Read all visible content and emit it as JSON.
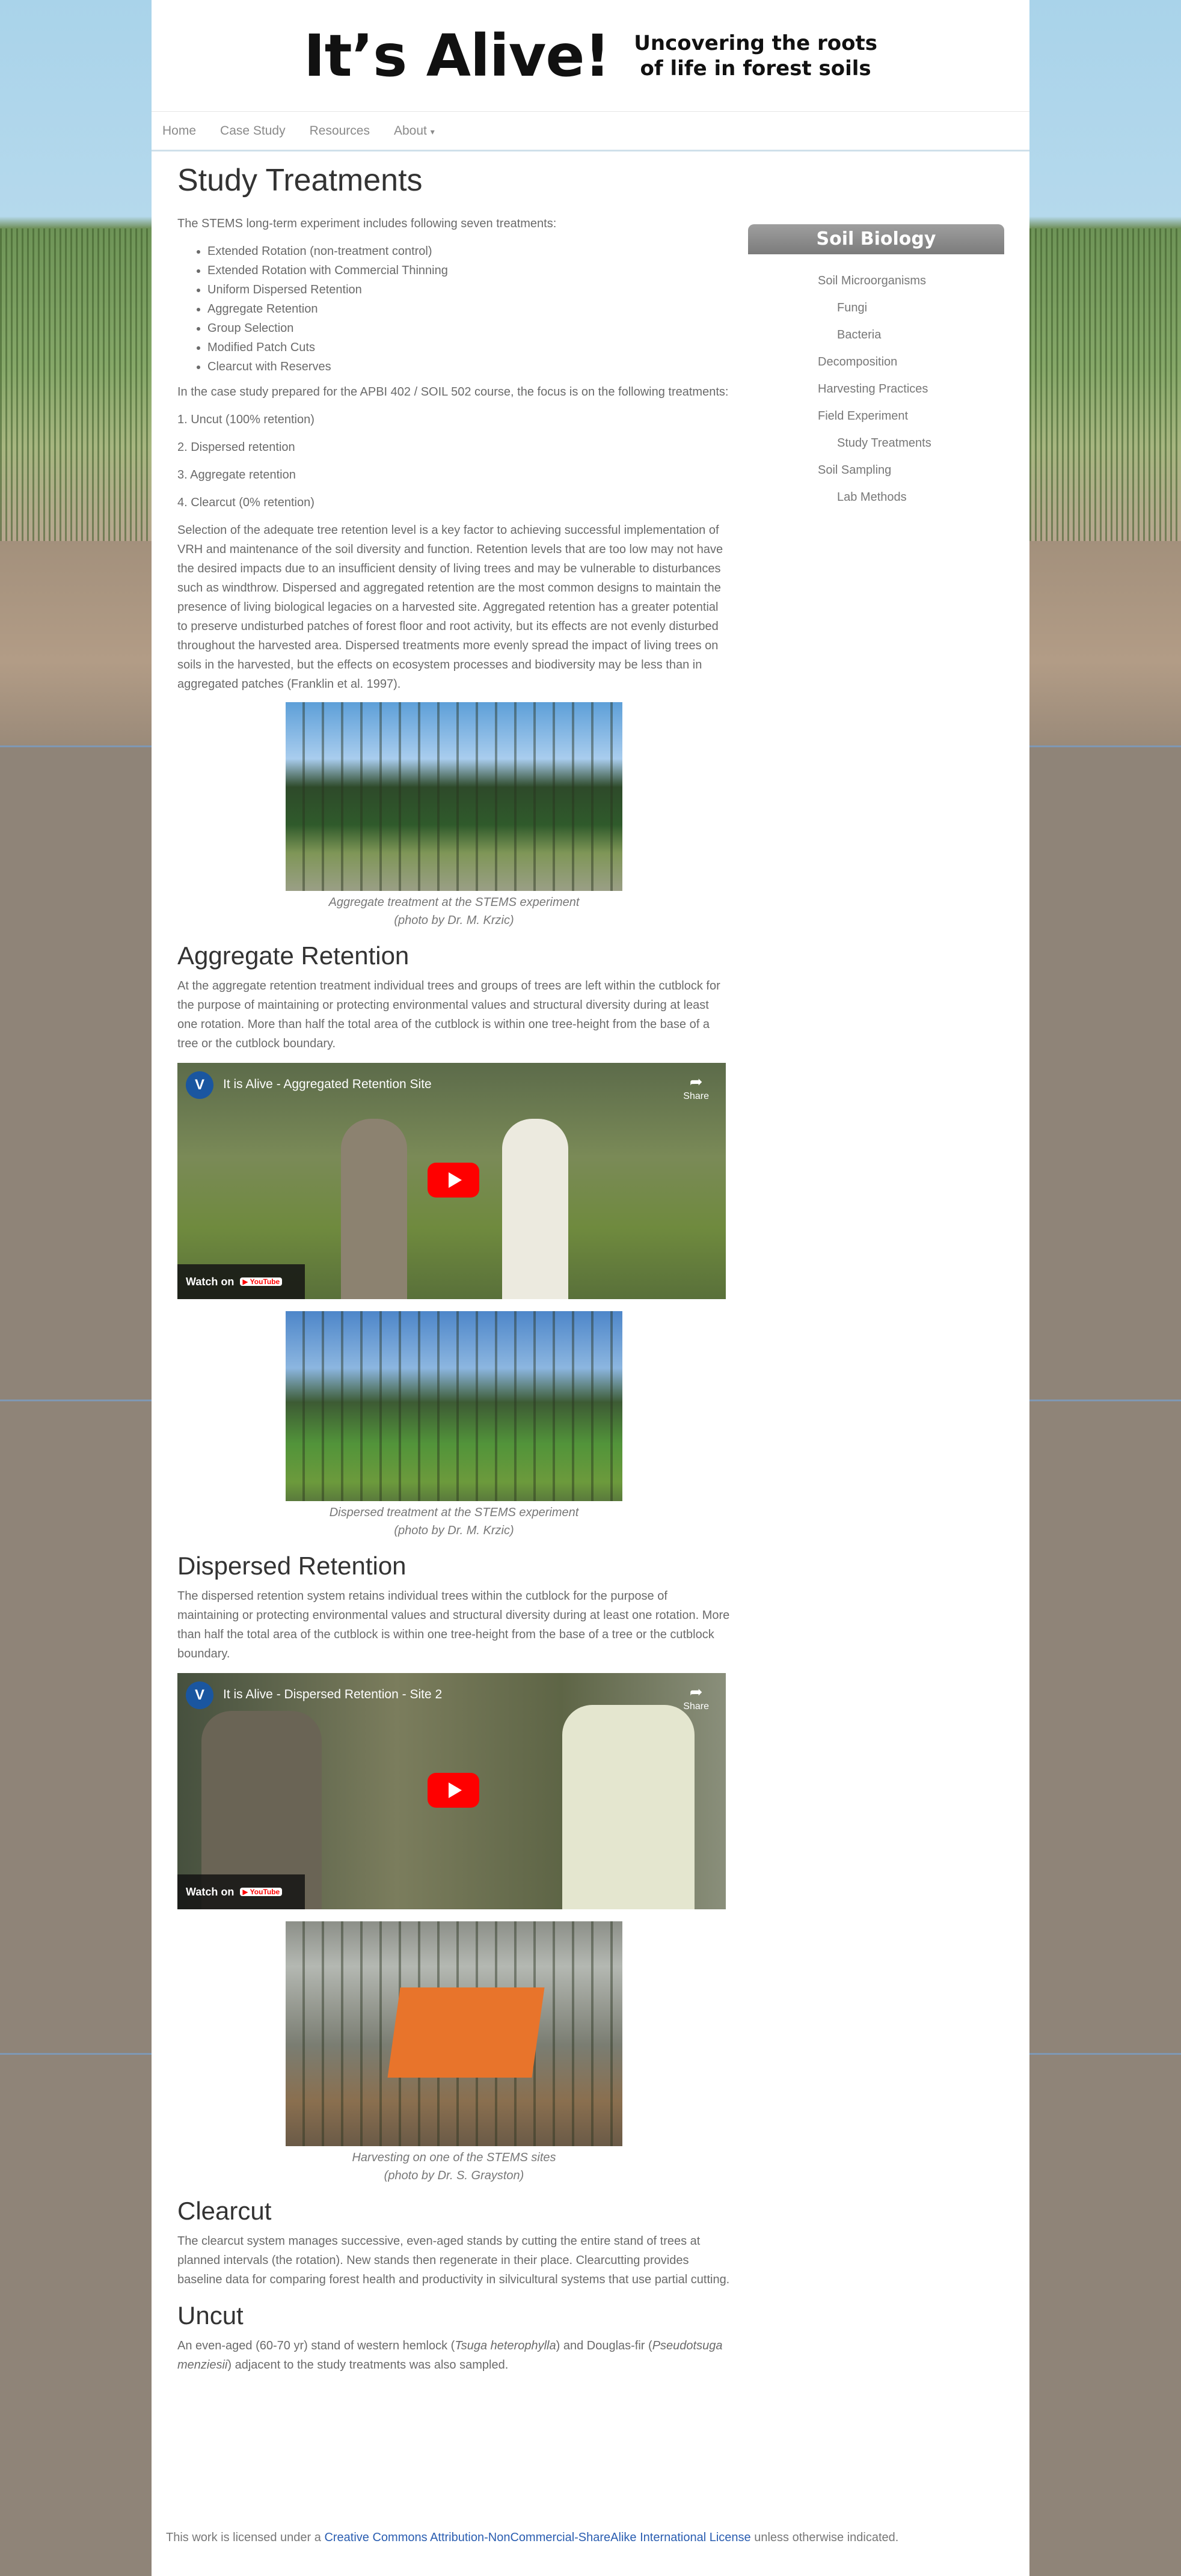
{
  "header": {
    "logo_text": "It’s Alive!",
    "tagline_line1": "Uncovering the roots",
    "tagline_line2": "of life in forest soils"
  },
  "nav": {
    "items": [
      "Home",
      "Case Study",
      "Resources",
      "About"
    ],
    "about_caret": "▾"
  },
  "main": {
    "title": "Study Treatments",
    "intro": "The STEMS long-term experiment includes following seven treatments:",
    "treatments": [
      "Extended Rotation (non-treatment control)",
      "Extended Rotation with Commercial Thinning",
      "Uniform Dispersed Retention",
      "Aggregate Retention",
      "Group Selection",
      "Modified Patch Cuts",
      "Clearcut with Reserves"
    ],
    "focus_text": "In the case study prepared for the APBI 402 / SOIL 502 course, the focus is on the following treatments:",
    "focus_items": [
      "1. Uncut (100% retention)",
      "2. Dispersed retention",
      "3. Aggregate retention",
      "4. Clearcut (0% retention)"
    ],
    "selection_paragraph": "Selection of the adequate tree retention level is a key factor to achieving successful implementation of VRH and maintenance of the soil diversity and function. Retention levels that are too low may not have the desired impacts due to an insufficient density of living trees and may be vulnerable to disturbances such as windthrow. Dispersed and aggregated retention are the most common designs to maintain the presence of living biological legacies on a harvested site. Aggregated retention has a greater potential to preserve undisturbed patches of forest floor and root activity, but its effects are not evenly disturbed throughout the harvested area.  Dispersed treatments more evenly spread the impact of living trees on soils in the harvested, but the effects on ecosystem processes and biodiversity may be less than in aggregated patches (Franklin et al.  1997).",
    "fig1": {
      "caption_line1": "Aggregate treatment at the STEMS experiment",
      "caption_line2": "(photo by Dr. M. Krzic)"
    },
    "aggregate": {
      "heading": "Aggregate Retention",
      "text": "At the aggregate retention treatment individual trees and groups of trees are left within the cutblock for the purpose of maintaining or protecting environmental values and structural diversity during at least one rotation. More than half the total area of the cutblock is within one tree-height from the base of a tree or the cutblock boundary.",
      "video_title": "It is Alive - Aggregated Retention Site"
    },
    "fig2": {
      "caption_line1": "Dispersed treatment at the STEMS experiment",
      "caption_line2": "(photo by Dr. M. Krzic)"
    },
    "dispersed": {
      "heading": "Dispersed Retention",
      "text": "The dispersed retention system retains individual trees within the cutblock for the purpose of maintaining or protecting environmental values and structural diversity during at least one rotation. More than half the total area of the cutblock is within one tree-height from the base of a tree or the cutblock boundary.",
      "video_title": "It is Alive - Dispersed Retention - Site 2"
    },
    "fig3": {
      "caption_line1": "Harvesting on one of the STEMS sites",
      "caption_line2": "(photo by Dr. S. Grayston)"
    },
    "clearcut": {
      "heading": "Clearcut",
      "text": "The clearcut system manages successive, even-aged stands by cutting the entire stand of trees at planned intervals (the rotation). New stands then regenerate in their place. Clearcutting provides baseline data for comparing forest health and productivity in silvicultural systems that use partial cutting."
    },
    "uncut": {
      "heading": "Uncut",
      "text_part1": "An even-aged (60-70 yr) stand of western hemlock (",
      "species1": "Tsuga heterophylla",
      "text_part2": ") and Douglas-fir (",
      "species2": "Pseudotsuga menziesii",
      "text_part3": ") adjacent to the study treatments was also sampled."
    }
  },
  "video": {
    "avatar_letter": "V",
    "share_label": "Share",
    "watch_on": "Watch on",
    "youtube": "▶ YouTube"
  },
  "sidebar": {
    "title": "Soil Biology",
    "items": [
      {
        "label": "Soil Microorganisms",
        "sub": false
      },
      {
        "label": "Fungi",
        "sub": true
      },
      {
        "label": "Bacteria",
        "sub": true
      },
      {
        "label": "Decomposition",
        "sub": false
      },
      {
        "label": "Harvesting Practices",
        "sub": false
      },
      {
        "label": "Field Experiment",
        "sub": false
      },
      {
        "label": "Study Treatments",
        "sub": true
      },
      {
        "label": "Soil Sampling",
        "sub": false
      },
      {
        "label": "Lab Methods",
        "sub": true
      }
    ]
  },
  "footer": {
    "prefix": "This work is licensed under a ",
    "link": "Creative Commons Attribution-NonCommercial-ShareAlike International License",
    "suffix": " unless otherwise indicated."
  },
  "colors": {
    "link": "#2a5db0",
    "play_button": "#ff0000",
    "sidebar_header": "#8a8a8a"
  }
}
